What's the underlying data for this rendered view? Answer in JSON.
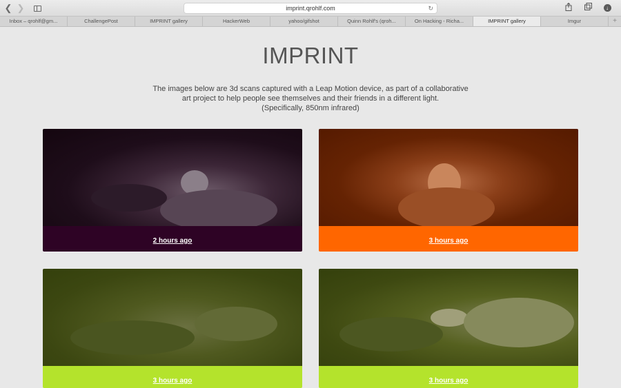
{
  "browser": {
    "url": "imprint.qrohlf.com",
    "tabs": [
      {
        "label": "Inbox – qrohlf@gm..."
      },
      {
        "label": "ChallengePost"
      },
      {
        "label": "IMPRINT gallery"
      },
      {
        "label": "HackerWeb"
      },
      {
        "label": "yahoo/gifshot"
      },
      {
        "label": "Quinn Rohlf's (qroh..."
      },
      {
        "label": "On Hacking - Richa..."
      },
      {
        "label": "IMPRINT gallery"
      },
      {
        "label": "Imgur"
      }
    ],
    "active_tab_index": 7,
    "icons": {
      "back": "chevron-left-icon",
      "forward": "chevron-right-icon",
      "sidebar": "sidebar-icon",
      "reload": "reload-icon",
      "share": "share-icon",
      "tabs": "tabs-overview-icon",
      "download": "download-icon",
      "new_tab": "plus-icon"
    }
  },
  "page": {
    "title": "IMPRINT",
    "description_lines": [
      "The images below are 3d scans captured with a Leap Motion device, as part of a collaborative",
      "art project to help people see themselves and their friends in a different light.",
      "(Specifically, 850nm infrared)"
    ]
  },
  "gallery": [
    {
      "time": "2 hours ago",
      "accent": "#2e0325",
      "tint": "#1e0d1a"
    },
    {
      "time": "3 hours ago",
      "accent": "#ff6600",
      "tint": "#652303"
    },
    {
      "time": "3 hours ago",
      "accent": "#b4e32c",
      "tint": "#3c4711"
    },
    {
      "time": "3 hours ago",
      "accent": "#b4e32c",
      "tint": "#3e4911"
    }
  ]
}
